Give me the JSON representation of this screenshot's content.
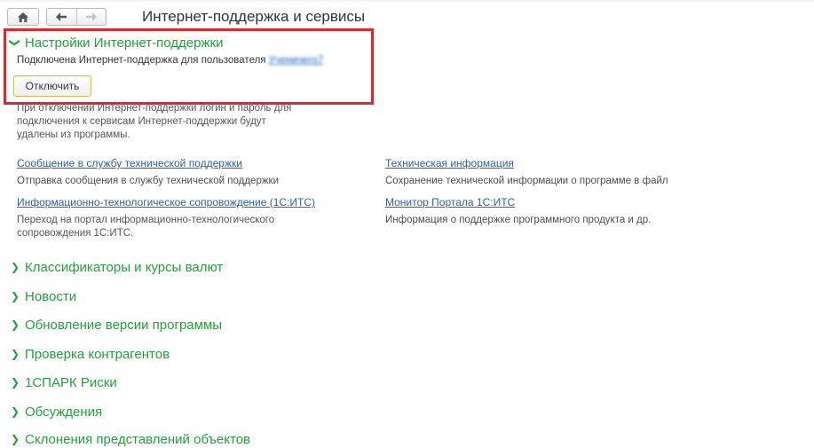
{
  "toolbar": {
    "home_icon": "home-icon",
    "back_icon": "arrow-left-icon",
    "forward_icon": "arrow-right-icon"
  },
  "page": {
    "title": "Интернет-поддержка и сервисы"
  },
  "settings_section": {
    "title": "Настройки Интернет-поддержки",
    "expanded": true,
    "status_text": "Подключена Интернет-поддержка для пользователя",
    "user_link": "Ученичего7",
    "disconnect_label": "Отключить",
    "note": "При отключении Интернет-поддержки логин и пароль для подключения к сервисам Интернет-поддержки будут удалены из программы."
  },
  "links": [
    {
      "label": "Сообщение в службу технической поддержки",
      "description": "Отправка сообщения в службу технической поддержки"
    },
    {
      "label": "Техническая информация",
      "description": "Сохранение технической информации о программе в файл"
    },
    {
      "label": "Информационно-технологическое сопровождение (1С:ИТС)",
      "description": "Переход на портал информационно-технологического сопровождения 1С:ИТС."
    },
    {
      "label": "Монитор Портала 1С:ИТС",
      "description": "Информация о поддержке программного продукта и др."
    }
  ],
  "sections": [
    {
      "title": "Классификаторы и курсы валют"
    },
    {
      "title": "Новости"
    },
    {
      "title": "Обновление версии программы"
    },
    {
      "title": "Проверка контрагентов"
    },
    {
      "title": "1СПАРК Риски"
    },
    {
      "title": "Обсуждения"
    },
    {
      "title": "Склонения представлений объектов"
    }
  ],
  "colors": {
    "section_green": "#239f3b",
    "link_blue": "#2b5fae",
    "highlight_red": "#e1262e"
  }
}
